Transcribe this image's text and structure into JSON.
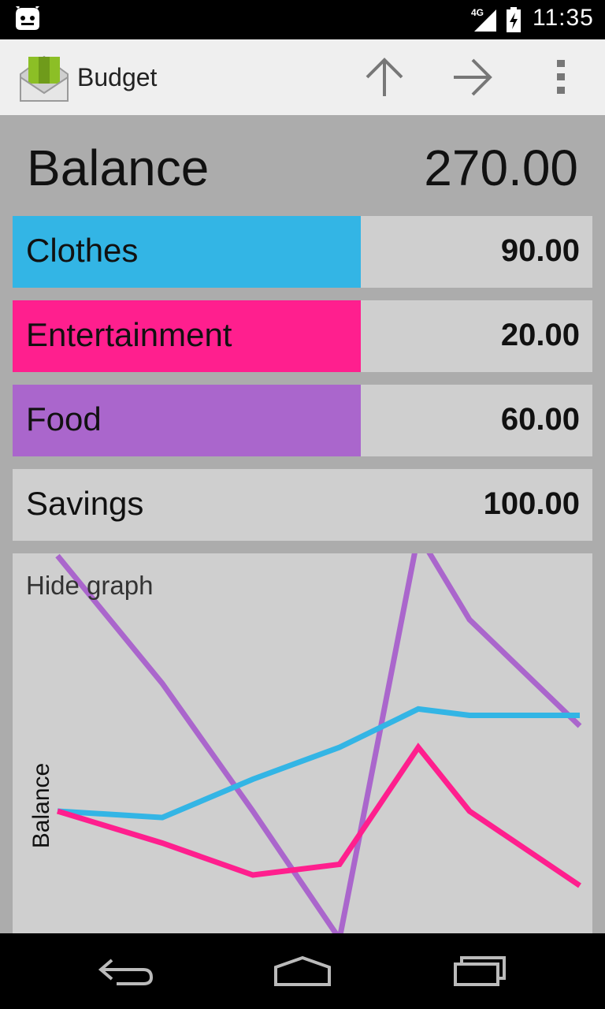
{
  "status_bar": {
    "network": "4G",
    "time": "11:35"
  },
  "action_bar": {
    "title": "Budget",
    "icons": [
      "app-budget-icon",
      "arrow-up-icon",
      "arrow-right-icon",
      "overflow-menu-icon"
    ]
  },
  "summary": {
    "label": "Balance",
    "value": "270.00"
  },
  "categories": [
    {
      "name": "Clothes",
      "amount": "90.00",
      "color": "#33b5e5",
      "fill": 0.6
    },
    {
      "name": "Entertainment",
      "amount": "20.00",
      "color": "#ff1f8e",
      "fill": 0.6
    },
    {
      "name": "Food",
      "amount": "60.00",
      "color": "#aa66cc",
      "fill": 0.6
    },
    {
      "name": "Savings",
      "amount": "100.00",
      "color": null,
      "fill": 0
    }
  ],
  "graph": {
    "toggle_label": "Hide graph"
  },
  "chart_data": {
    "type": "line",
    "ylabel": "Balance",
    "series": [
      {
        "color": "#aa66cc",
        "values": [
          210,
          150,
          90,
          30,
          220,
          180,
          130
        ]
      },
      {
        "color": "#33b5e5",
        "values": [
          90,
          87,
          105,
          120,
          138,
          135,
          135
        ]
      },
      {
        "color": "#ff1f8e",
        "values": [
          90,
          75,
          60,
          65,
          120,
          90,
          55
        ]
      }
    ]
  },
  "nav_bar": {
    "icons": [
      "back-icon",
      "home-icon",
      "recent-apps-icon"
    ]
  }
}
